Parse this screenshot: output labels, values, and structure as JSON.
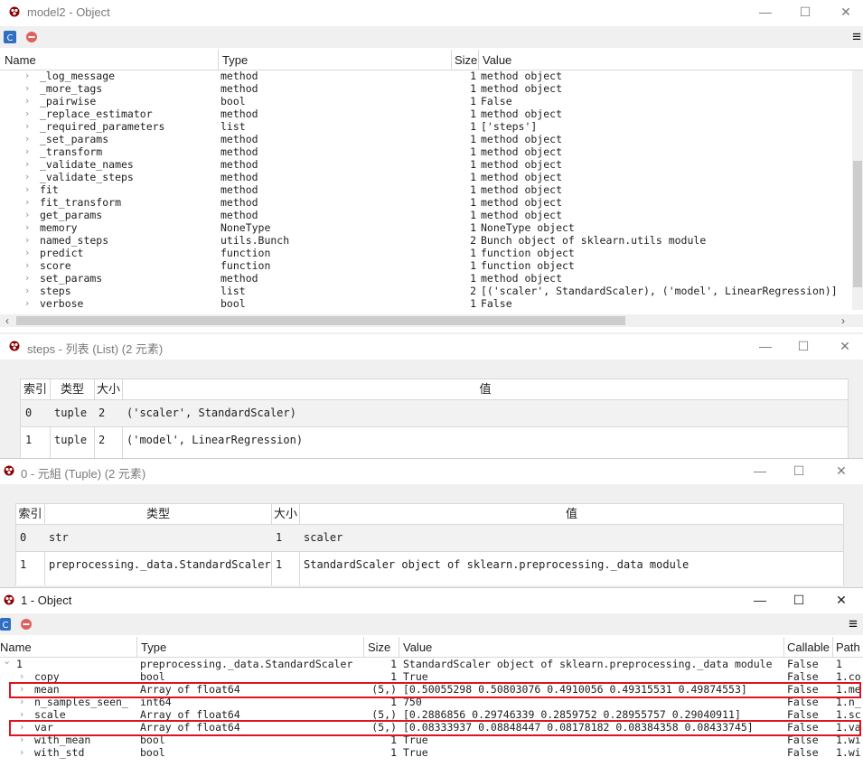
{
  "win1": {
    "title": "model2 - Object",
    "columns": [
      "Name",
      "Type",
      "Size",
      "Value"
    ],
    "rows": [
      {
        "name": "_log_message",
        "type": "method",
        "size": "1",
        "value": "method object"
      },
      {
        "name": "_more_tags",
        "type": "method",
        "size": "1",
        "value": "method object"
      },
      {
        "name": "_pairwise",
        "type": "bool",
        "size": "1",
        "value": "False"
      },
      {
        "name": "_replace_estimator",
        "type": "method",
        "size": "1",
        "value": "method object"
      },
      {
        "name": "_required_parameters",
        "type": "list",
        "size": "1",
        "value": "['steps']"
      },
      {
        "name": "_set_params",
        "type": "method",
        "size": "1",
        "value": "method object"
      },
      {
        "name": "_transform",
        "type": "method",
        "size": "1",
        "value": "method object"
      },
      {
        "name": "_validate_names",
        "type": "method",
        "size": "1",
        "value": "method object"
      },
      {
        "name": "_validate_steps",
        "type": "method",
        "size": "1",
        "value": "method object"
      },
      {
        "name": "fit",
        "type": "method",
        "size": "1",
        "value": "method object"
      },
      {
        "name": "fit_transform",
        "type": "method",
        "size": "1",
        "value": "method object"
      },
      {
        "name": "get_params",
        "type": "method",
        "size": "1",
        "value": "method object"
      },
      {
        "name": "memory",
        "type": "NoneType",
        "size": "1",
        "value": "NoneType object"
      },
      {
        "name": "named_steps",
        "type": "utils.Bunch",
        "size": "2",
        "value": "Bunch object of sklearn.utils module"
      },
      {
        "name": "predict",
        "type": "function",
        "size": "1",
        "value": "function object"
      },
      {
        "name": "score",
        "type": "function",
        "size": "1",
        "value": "function object"
      },
      {
        "name": "set_params",
        "type": "method",
        "size": "1",
        "value": "method object"
      },
      {
        "name": "steps",
        "type": "list",
        "size": "2",
        "value": "[('scaler', StandardScaler), ('model', LinearRegression)]"
      },
      {
        "name": "verbose",
        "type": "bool",
        "size": "1",
        "value": "False"
      }
    ]
  },
  "win2": {
    "title": "steps - 列表 (List) (2 元素)",
    "columns": [
      "索引",
      "类型",
      "大小",
      "值"
    ],
    "rows": [
      {
        "index": "0",
        "type": "tuple",
        "size": "2",
        "value": "('scaler', StandardScaler)"
      },
      {
        "index": "1",
        "type": "tuple",
        "size": "2",
        "value": "('model', LinearRegression)"
      }
    ]
  },
  "win3": {
    "title": "0 - 元組 (Tuple) (2 元素)",
    "columns": [
      "索引",
      "类型",
      "大小",
      "值"
    ],
    "rows": [
      {
        "index": "0",
        "type": "str",
        "size": "1",
        "value": "scaler"
      },
      {
        "index": "1",
        "type": "preprocessing._data.StandardScaler",
        "size": "1",
        "value": "StandardScaler object of sklearn.preprocessing._data module"
      }
    ]
  },
  "win4": {
    "title": "1 - Object",
    "columns": [
      "Name",
      "Type",
      "Size",
      "Value",
      "Callable",
      "Path"
    ],
    "root": {
      "name": "1",
      "type": "preprocessing._data.StandardScaler",
      "size": "1",
      "value": "StandardScaler object of sklearn.preprocessing._data module",
      "callable": "False",
      "path": "1"
    },
    "rows": [
      {
        "name": "copy",
        "type": "bool",
        "size": "1",
        "value": "True",
        "callable": "False",
        "path": "1.co"
      },
      {
        "name": "mean",
        "type": "Array of float64",
        "size": "(5,)",
        "value": "[0.50055298 0.50803076 0.4910056  0.49315531 0.49874553]",
        "callable": "False",
        "path": "1.me"
      },
      {
        "name": "n_samples_seen_",
        "type": "int64",
        "size": "1",
        "value": "750",
        "callable": "False",
        "path": "1.n_"
      },
      {
        "name": "scale",
        "type": "Array of float64",
        "size": "(5,)",
        "value": "[0.2886856  0.29746339 0.2859752  0.28955757 0.29040911]",
        "callable": "False",
        "path": "1.sc"
      },
      {
        "name": "var",
        "type": "Array of float64",
        "size": "(5,)",
        "value": "[0.08333937 0.08848447 0.08178182 0.08384358 0.08433745]",
        "callable": "False",
        "path": "1.va"
      },
      {
        "name": "with_mean",
        "type": "bool",
        "size": "1",
        "value": "True",
        "callable": "False",
        "path": "1.wi"
      },
      {
        "name": "with_std",
        "type": "bool",
        "size": "1",
        "value": "True",
        "callable": "False",
        "path": "1.wi"
      }
    ]
  },
  "controls": {
    "minimize": "—",
    "maximize": "☐",
    "close": "✕",
    "menu": "≡",
    "chevron": "›",
    "expanded": "⌄",
    "scroll_left": "‹",
    "scroll_right": "›"
  }
}
